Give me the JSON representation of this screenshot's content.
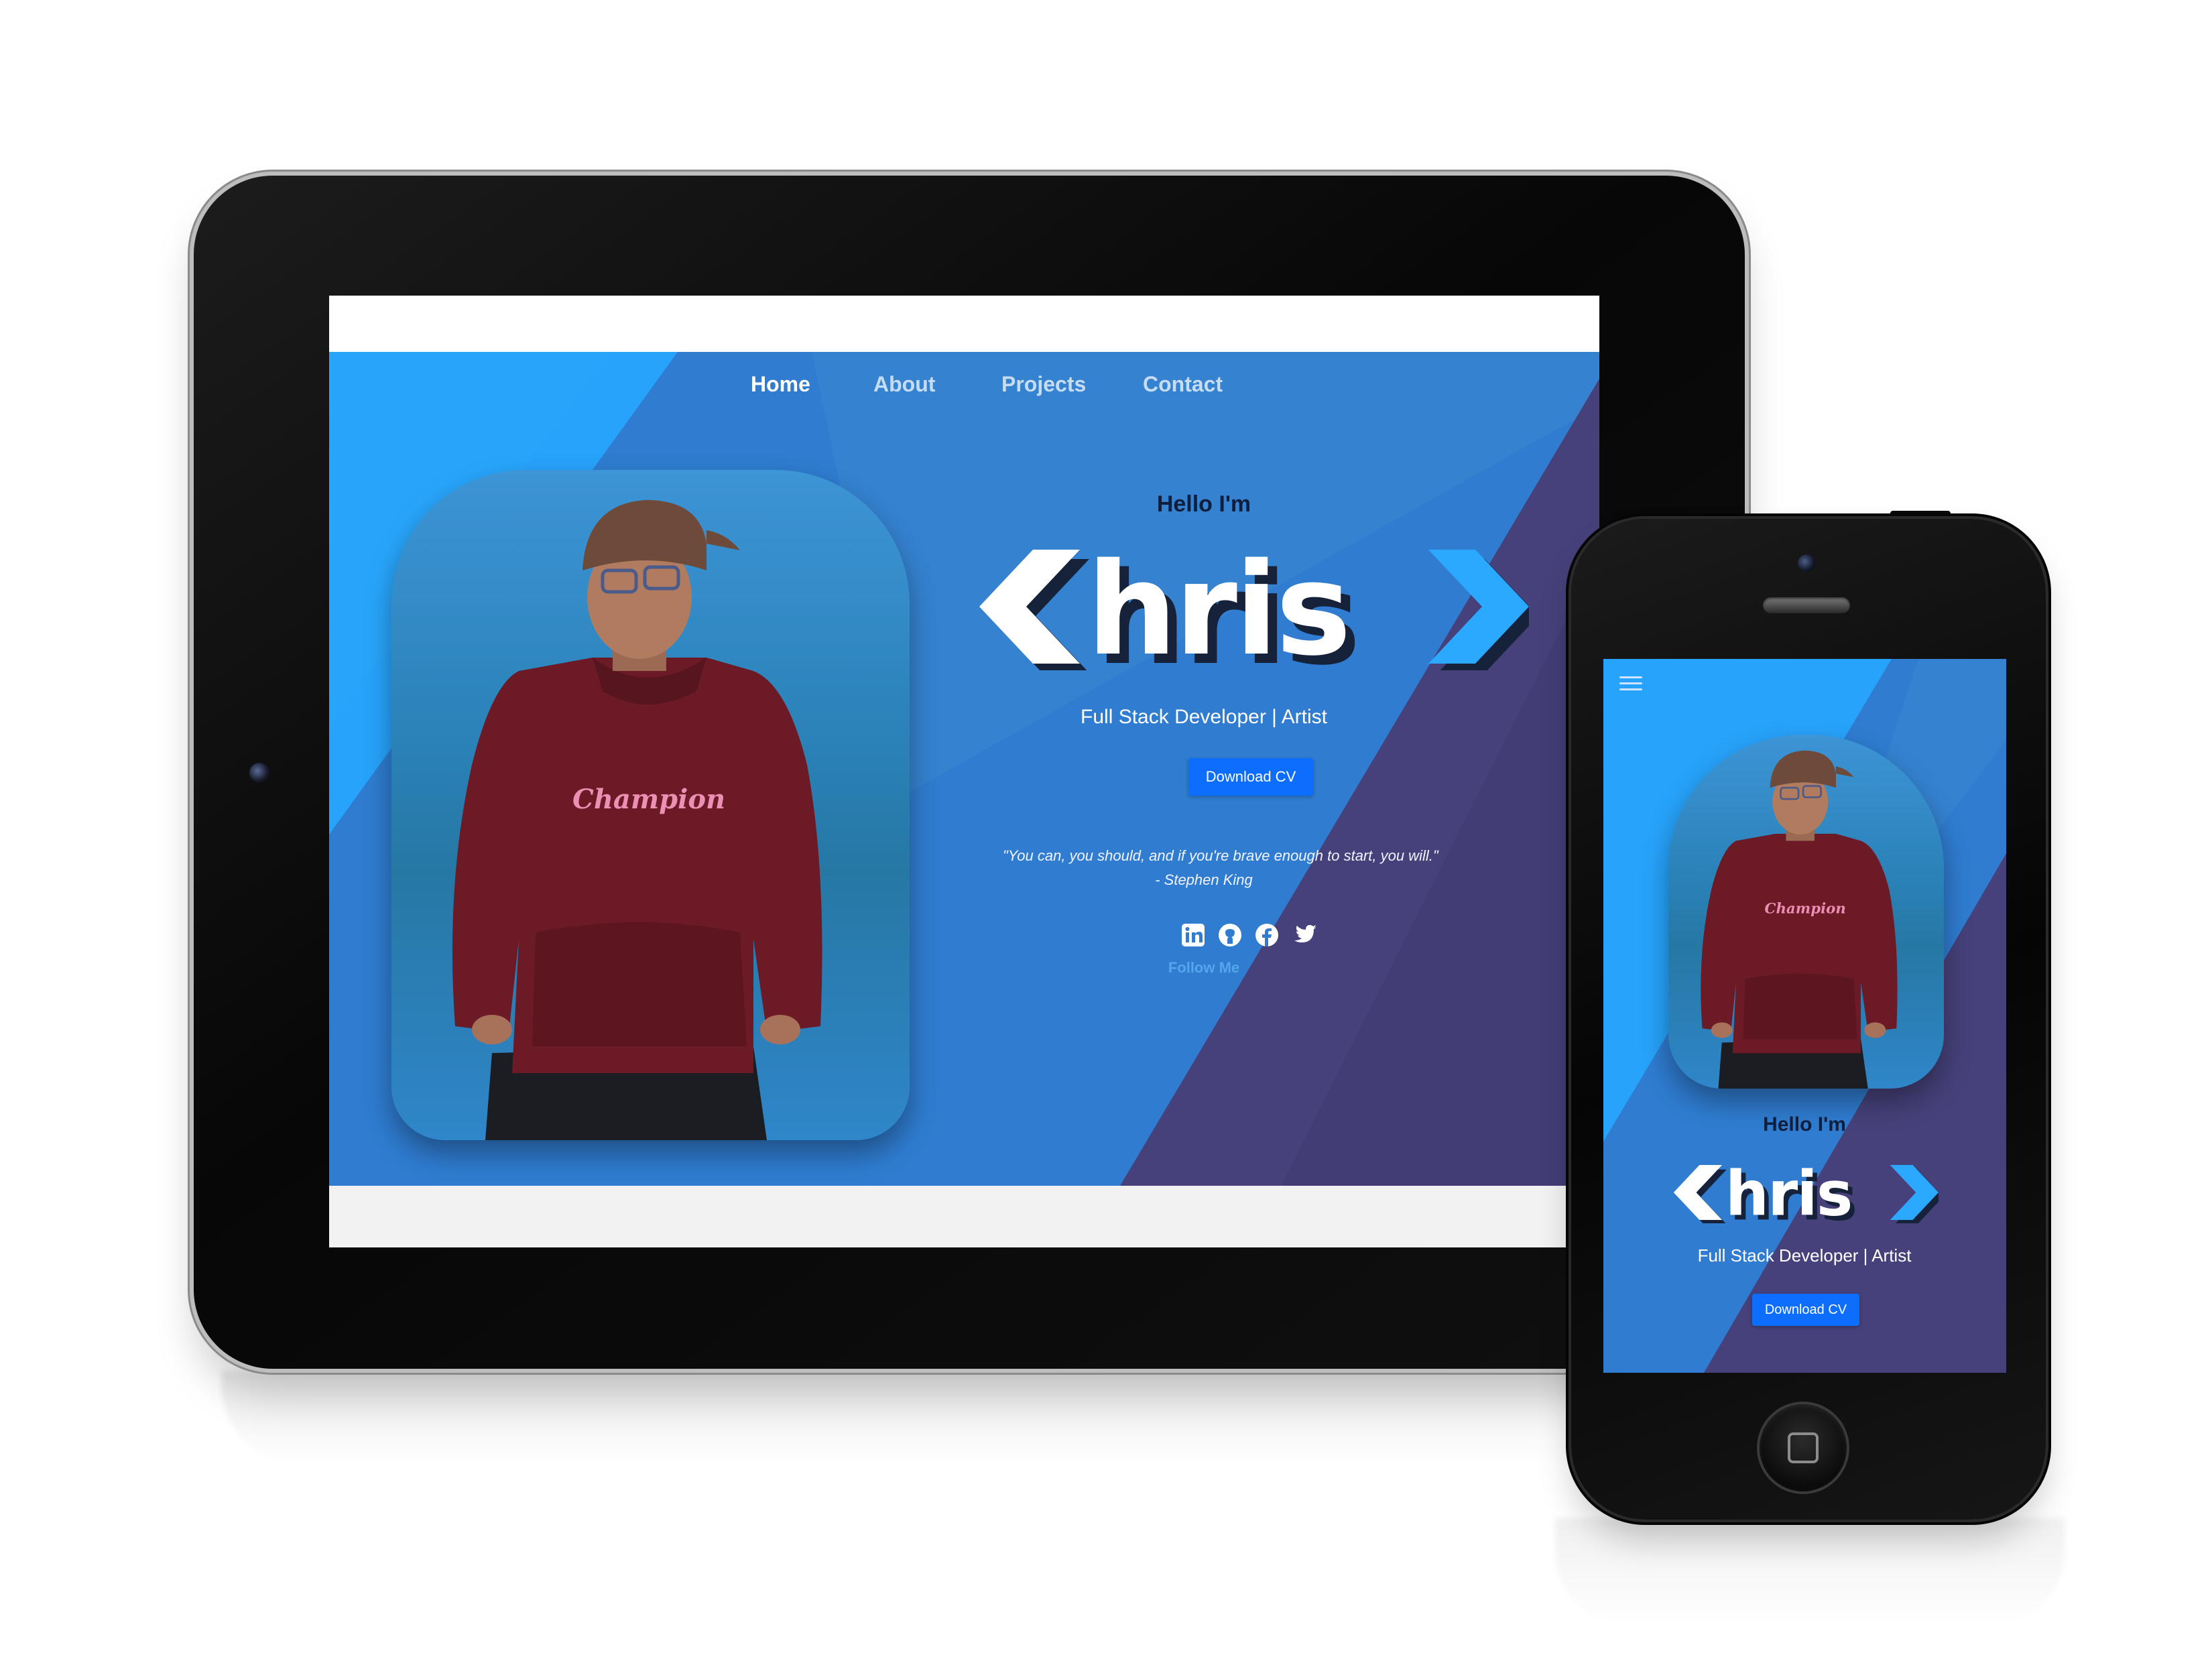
{
  "tablet": {
    "nav": {
      "items": [
        {
          "label": "Home",
          "active": true
        },
        {
          "label": "About",
          "active": false
        },
        {
          "label": "Projects",
          "active": false
        },
        {
          "label": "Contact",
          "active": false
        }
      ]
    },
    "hero": {
      "greeting": "Hello I'm",
      "logo_text": "Chris",
      "subtitle": "Full Stack Developer | Artist",
      "cta_label": "Download CV",
      "quote_line1": "\"You can, you should, and if you're brave enough to start, you will.\"",
      "quote_line2": "- Stephen King",
      "social_icons": [
        "linkedin-icon",
        "github-icon",
        "facebook-icon",
        "twitter-icon"
      ],
      "follow_label": "Follow Me",
      "shirt_text": "Champion"
    }
  },
  "phone": {
    "menu_icon": "hamburger-menu-icon",
    "greeting": "Hello I'm",
    "logo_text": "Chris",
    "subtitle": "Full Stack Developer | Artist",
    "cta_label": "Download CV",
    "shirt_text": "Champion"
  },
  "colors": {
    "hero_blue": "#2f7cd0",
    "hero_light": "#27a3fb",
    "hero_purple": "#46417a",
    "button_blue": "#0d6efd",
    "follow_blue": "#53a6ee"
  }
}
